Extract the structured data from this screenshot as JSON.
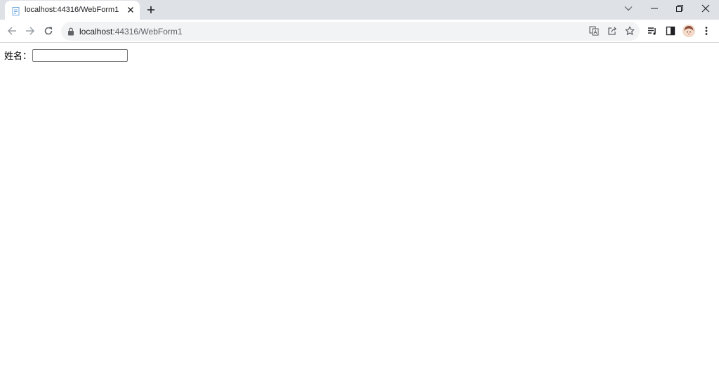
{
  "tab": {
    "title": "localhost:44316/WebForm1",
    "favicon": "page-icon"
  },
  "toolbar": {
    "url_host": "localhost",
    "url_path": ":44316/WebForm1"
  },
  "form": {
    "name_label": "姓名：",
    "name_value": ""
  },
  "colors": {
    "tabstrip_bg": "#dee1e6",
    "omnibox_bg": "#f1f3f4",
    "icon": "#5f6368"
  }
}
